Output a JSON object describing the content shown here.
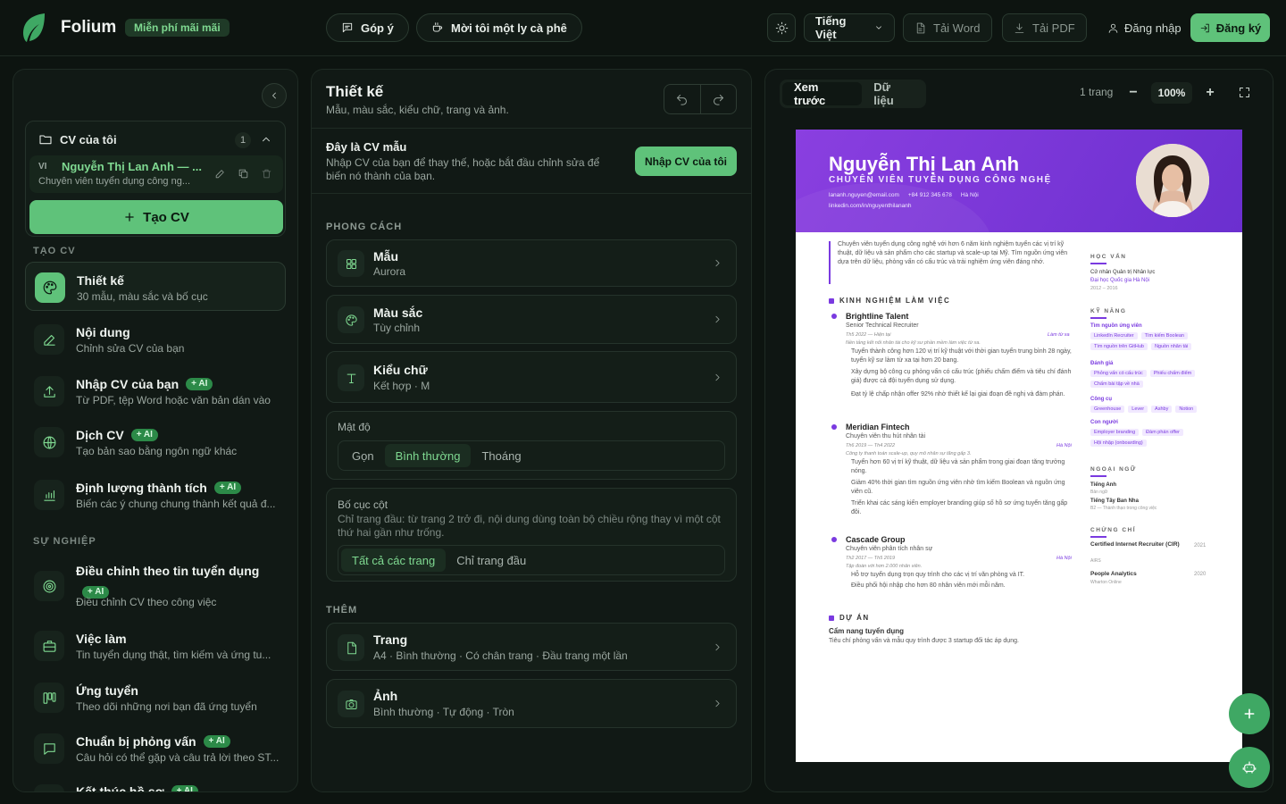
{
  "header": {
    "brand": "Folium",
    "free_badge": "Miễn phí mãi mãi",
    "feedback": "Góp ý",
    "coffee": "Mời tôi một ly cà phê",
    "language": "Tiếng Việt",
    "download_word": "Tải Word",
    "download_pdf": "Tải PDF",
    "login": "Đăng nhập",
    "signup": "Đăng ký"
  },
  "sidebar": {
    "my_cv_title": "CV của tôi",
    "my_cv_count": "1",
    "cv_item": {
      "lang": "VI",
      "name": "Nguyễn Thị Lan Anh — ...",
      "subtitle": "Chuyên viên tuyển dụng công ng..."
    },
    "create_button": "Tạo CV",
    "section_create": "TẠO CV",
    "section_career": "SỰ NGHIỆP",
    "ai_badge": "+ AI",
    "items": [
      {
        "title": "Thiết kế",
        "subtitle": "30 mẫu, màu sắc và bố cục"
      },
      {
        "title": "Nội dung",
        "subtitle": "Chỉnh sửa CV của bạn"
      },
      {
        "title": "Nhập CV của bạn",
        "subtitle": "Từ PDF, tệp Word hoặc văn bản dán vào"
      },
      {
        "title": "Dịch CV",
        "subtitle": "Tạo bản sao bằng ngôn ngữ khác"
      },
      {
        "title": "Định lượng thành tích",
        "subtitle": "Biến các ý chung chung thành kết quả đ..."
      },
      {
        "title": "Điều chỉnh theo tin tuyển dụng",
        "subtitle": "Điều chỉnh CV theo công việc"
      },
      {
        "title": "Việc làm",
        "subtitle": "Tin tuyển dụng thật, tìm kiếm và ứng tu..."
      },
      {
        "title": "Ứng tuyển",
        "subtitle": "Theo dõi những nơi bạn đã ứng tuyển"
      },
      {
        "title": "Chuẩn bị phỏng vấn",
        "subtitle": "Câu hỏi có thể gặp và câu trả lời theo ST..."
      },
      {
        "title": "Kết thúc hồ sơ",
        "subtitle": ""
      }
    ]
  },
  "design": {
    "title": "Thiết kế",
    "subtitle": "Mẫu, màu sắc, kiểu chữ, trang và ảnh.",
    "sample_title": "Đây là CV mẫu",
    "sample_text": "Nhập CV của bạn để thay thế, hoặc bắt đầu chỉnh sửa để biến nó thành của bạn.",
    "import_button": "Nhập CV của tôi",
    "style_label": "PHONG CÁCH",
    "template": {
      "title": "Mẫu",
      "value": "Aurora"
    },
    "color": {
      "title": "Màu sắc",
      "value": "Tùy chỉnh"
    },
    "font": {
      "title": "Kiểu chữ",
      "value": "Kết hợp · M"
    },
    "density_label": "Mật độ",
    "density_options": [
      "Gọn",
      "Bình thường",
      "Thoáng"
    ],
    "columns_label": "Bố cục cột",
    "columns_help": "Chỉ trang đầu: từ trang 2 trở đi, nội dung dùng toàn bộ chiều rộng thay vì một cột thứ hai gần như trống.",
    "columns_options": [
      "Tất cả các trang",
      "Chỉ trang đầu"
    ],
    "more_label": "THÊM",
    "page": {
      "title": "Trang",
      "value": "A4 · Bình thường · Có chân trang · Đầu trang một lần"
    },
    "photo": {
      "title": "Ảnh",
      "value": "Bình thường · Tự động · Tròn"
    }
  },
  "preview": {
    "tab_preview": "Xem trước",
    "tab_data": "Dữ liệu",
    "pages": "1 trang",
    "zoom": "100%",
    "cv": {
      "name": "Nguyễn Thị Lan Anh",
      "role": "CHUYÊN VIÊN TUYỂN DỤNG CÔNG NGHỆ",
      "email": "lananh.nguyen@email.com",
      "phone": "+84 912 345 678",
      "city": "Hà Nội",
      "linkedin": "linkedin.com/in/nguyenthilananh",
      "summary": "Chuyên viên tuyển dụng công nghệ với hơn 6 năm kinh nghiệm tuyển các vị trí kỹ thuật, dữ liệu và sản phẩm cho các startup và scale-up tại Mỹ. Tìm nguồn ứng viên dựa trên dữ liệu, phỏng vấn có cấu trúc và trải nghiệm ứng viên đáng nhớ.",
      "exp_heading": "KINH NGHIỆM LÀM VIỆC",
      "jobs": [
        {
          "company": "Brightline Talent",
          "title": "Senior Technical Recruiter",
          "dates": "Th5 2022 — Hiện tại",
          "loc": "Làm từ xa",
          "desc": "Nền tảng kết nối nhân tài cho kỹ sư phần mềm làm việc từ xa.",
          "b1": "Tuyển thành công hơn 120 vị trí kỹ thuật với thời gian tuyển trung bình 28 ngày, tuyển kỹ sư làm từ xa tại hơn 20 bang.",
          "b2": "Xây dựng bộ công cụ phỏng vấn có cấu trúc (phiếu chấm điểm và tiêu chí đánh giá) được cả đội tuyển dụng sử dụng.",
          "b3": "Đạt tỷ lệ chấp nhận offer 92% nhờ thiết kế lại giai đoạn đề nghị và đàm phán."
        },
        {
          "company": "Meridian Fintech",
          "title": "Chuyên viên thu hút nhân tài",
          "dates": "Th6 2019 — Th4 2022",
          "loc": "Hà Nội",
          "desc": "Công ty thanh toán scale-up, quy mô nhân sự tăng gấp 3.",
          "b1": "Tuyển hơn 60 vị trí kỹ thuật, dữ liệu và sản phẩm trong giai đoạn tăng trưởng nóng.",
          "b2": "Giảm 40% thời gian tìm nguồn ứng viên nhờ tìm kiếm Boolean và nguồn ứng viên cũ.",
          "b3": "Triển khai các sáng kiến employer branding giúp số hồ sơ ứng tuyển tăng gấp đôi."
        },
        {
          "company": "Cascade Group",
          "title": "Chuyên viên phân tích nhân sự",
          "dates": "Th2 2017 — Th5 2019",
          "loc": "Hà Nội",
          "desc": "Tập đoàn với hơn 2.000 nhân viên.",
          "b1": "Hỗ trợ tuyển dụng trọn quy trình cho các vị trí văn phòng và IT.",
          "b2": "Điều phối hội nhập cho hơn 80 nhân viên mới mỗi năm."
        }
      ],
      "projects_heading": "DỰ ÁN",
      "project_title": "Cẩm nang tuyển dụng",
      "project_desc": "Tiêu chí phỏng vấn và mẫu quy trình được 3 startup đối tác áp dụng.",
      "edu_heading": "HỌC VẤN",
      "edu_degree": "Cử nhân Quản trị Nhân lực",
      "edu_school": "Đại học Quốc gia Hà Nội",
      "edu_dates": "2012 – 2016",
      "skills_heading": "KỸ NĂNG",
      "skill_groups": [
        {
          "name": "Tìm nguồn ứng viên",
          "tags": [
            "LinkedIn Recruiter",
            "Tìm kiếm Boolean",
            "Tìm nguồn trên GitHub",
            "Nguồn nhân tài"
          ]
        },
        {
          "name": "Đánh giá",
          "tags": [
            "Phỏng vấn có cấu trúc",
            "Phiếu chấm điểm",
            "Chấm bài tập về nhà"
          ]
        },
        {
          "name": "Công cụ",
          "tags": [
            "Greenhouse",
            "Lever",
            "Ashby",
            "Notion"
          ]
        },
        {
          "name": "Con người",
          "tags": [
            "Employer branding",
            "Đàm phán offer",
            "Hội nhập (onboarding)"
          ]
        }
      ],
      "lang_heading": "NGOẠI NGỮ",
      "langs": [
        {
          "name": "Tiếng Anh",
          "level": "Bản ngữ"
        },
        {
          "name": "Tiếng Tây Ban Nha",
          "level": "B2 — Thành thạo trong công việc"
        }
      ],
      "cert_heading": "CHỨNG CHỈ",
      "certs": [
        {
          "name": "Certified Internet Recruiter (CIR)",
          "org": "AIRS",
          "year": "2021"
        },
        {
          "name": "People Analytics",
          "org": "Wharton Online",
          "year": "2020"
        }
      ]
    }
  }
}
